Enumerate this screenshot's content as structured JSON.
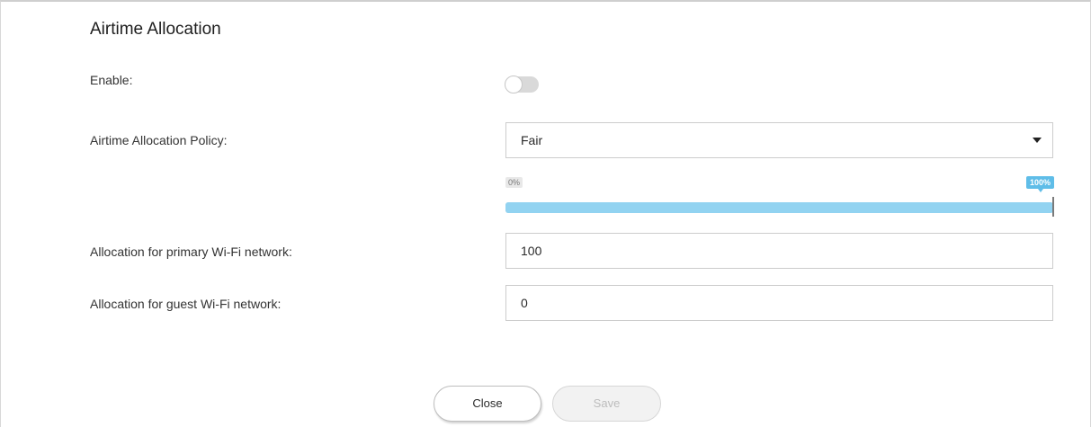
{
  "dialog": {
    "title": "Airtime Allocation"
  },
  "enable": {
    "label": "Enable:",
    "value": false
  },
  "policy": {
    "label": "Airtime Allocation Policy:",
    "selected": "Fair"
  },
  "slider": {
    "min_label": "0%",
    "max_label": "100%",
    "value_percent": 100
  },
  "primary": {
    "label": "Allocation for primary Wi-Fi network:",
    "value": "100"
  },
  "guest": {
    "label": "Allocation for guest Wi-Fi network:",
    "value": "0"
  },
  "buttons": {
    "close": "Close",
    "save": "Save"
  },
  "colors": {
    "slider_fill": "#92d3f1",
    "badge_accent": "#5fbde8",
    "toggle_off": "#d9d9d9"
  },
  "icons": {
    "select_caret": "caret-down-icon"
  }
}
